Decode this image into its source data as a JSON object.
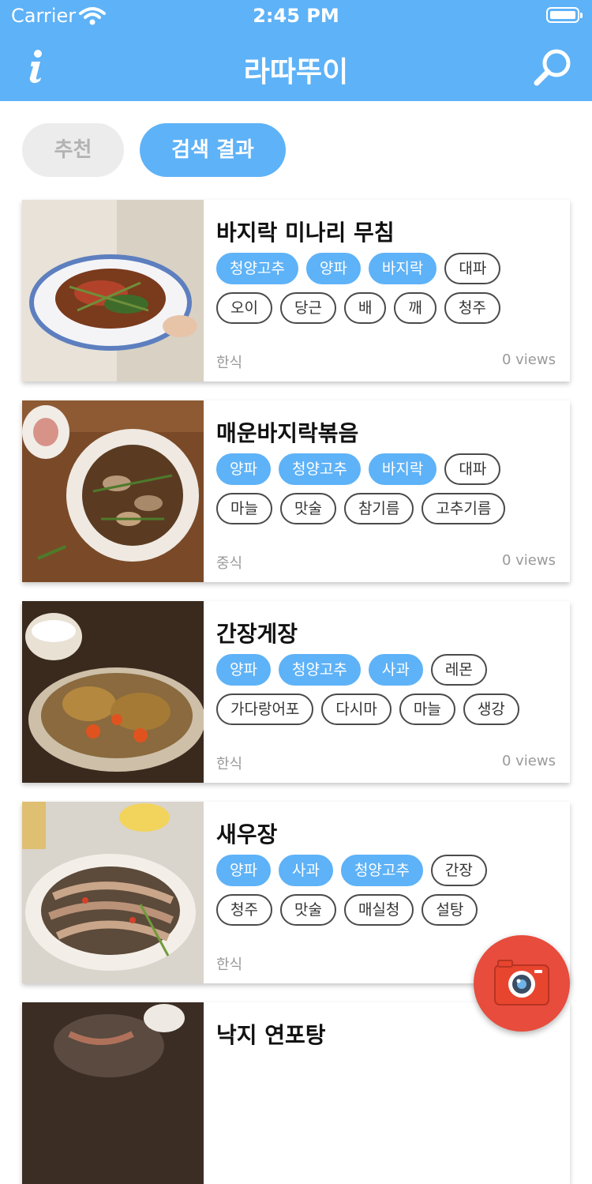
{
  "status_bar": {
    "carrier": "Carrier",
    "time": "2:45 PM"
  },
  "nav": {
    "title": "라따뚜이",
    "info_icon": "info-icon",
    "search_icon": "search-icon"
  },
  "tabs": {
    "recommend": "추천",
    "search_results": "검색 결과",
    "active": "search_results"
  },
  "recipes": [
    {
      "name": "바지락 미나리 무침",
      "highlight_tags": [
        "청양고추",
        "양파",
        "바지락"
      ],
      "rows": [
        [
          "청양고추",
          "양파",
          "바지락",
          "대파"
        ],
        [
          "오이",
          "당근",
          "배",
          "깨",
          "청주"
        ]
      ],
      "highlight_counts": [
        3,
        0
      ],
      "category": "한식",
      "views": "0 views"
    },
    {
      "name": "매운바지락볶음",
      "rows": [
        [
          "양파",
          "청양고추",
          "바지락",
          "대파"
        ],
        [
          "마늘",
          "맛술",
          "참기름",
          "고추기름"
        ]
      ],
      "highlight_counts": [
        3,
        0
      ],
      "category": "중식",
      "views": "0 views"
    },
    {
      "name": "간장게장",
      "rows": [
        [
          "양파",
          "청양고추",
          "사과",
          "레몬"
        ],
        [
          "가다랑어포",
          "다시마",
          "마늘",
          "생강"
        ]
      ],
      "highlight_counts": [
        3,
        0
      ],
      "category": "한식",
      "views": "0 views"
    },
    {
      "name": "새우장",
      "rows": [
        [
          "양파",
          "사과",
          "청양고추",
          "간장"
        ],
        [
          "청주",
          "맛술",
          "매실청",
          "설탕"
        ]
      ],
      "highlight_counts": [
        3,
        0
      ],
      "category": "한식",
      "views": ""
    },
    {
      "name": "낙지 연포탕",
      "rows": [],
      "highlight_counts": [
        0,
        0
      ],
      "category": "",
      "views": ""
    }
  ],
  "fab": {
    "icon": "camera-icon"
  },
  "colors": {
    "primary": "#5eb2f7",
    "fab": "#e74c3c",
    "tab_inactive": "#ececec"
  }
}
